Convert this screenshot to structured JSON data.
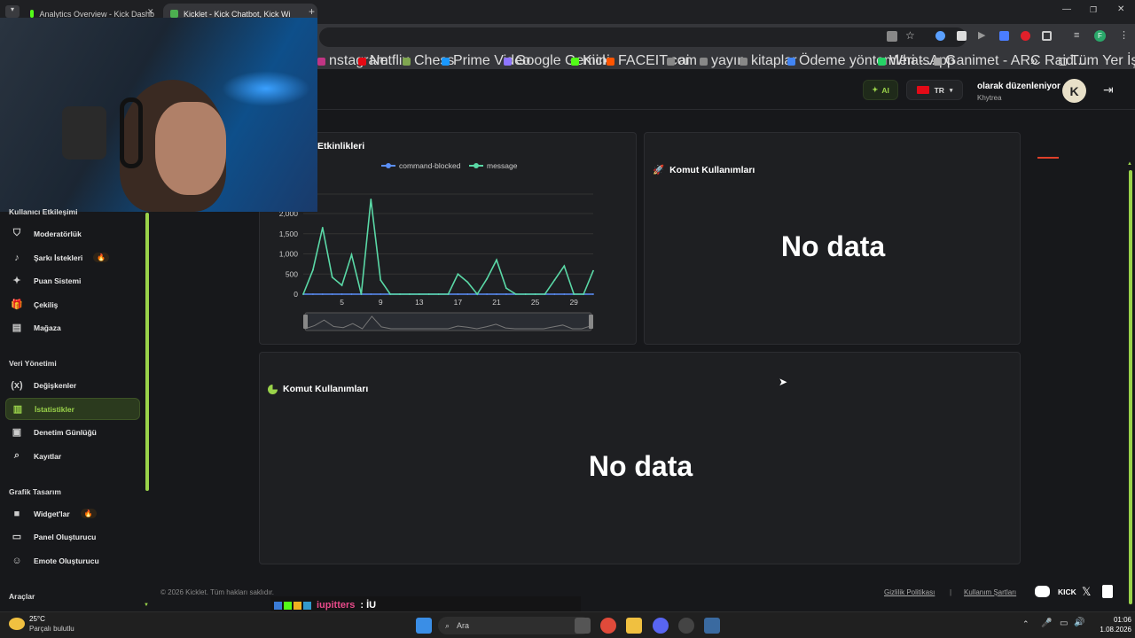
{
  "browser": {
    "tabs": [
      {
        "title": "Analytics Overview - Kick Dashb",
        "active": false
      },
      {
        "title": "Kicklet - Kick Chatbot, Kick Wi",
        "active": true
      }
    ],
    "bookmarks": [
      {
        "label": "nstagram",
        "color": "#c13584"
      },
      {
        "label": "Netflix",
        "color": "#e50914"
      },
      {
        "label": "Chess",
        "color": "#7fa650"
      },
      {
        "label": "Prime Video",
        "color": "#1a98ff"
      },
      {
        "label": "Google Gemini",
        "color": "#8e75ff"
      },
      {
        "label": "Kick",
        "color": "#53fc18"
      },
      {
        "label": "FACEIT.com",
        "color": "#ff5500"
      },
      {
        "label": "ai",
        "color": "#888888"
      },
      {
        "label": "yayın",
        "color": "#888888"
      },
      {
        "label": "kitaplar",
        "color": "#888888"
      },
      {
        "label": "Ödeme yöntemleri -...",
        "color": "#4285f4"
      },
      {
        "label": "WhatsApp",
        "color": "#25d366"
      },
      {
        "label": "Ganimet - ARC Raid...",
        "color": "#aaaaaa"
      }
    ],
    "bookmarks_more": "»",
    "all_bookmarks": "Tüm Yer İşaretleri"
  },
  "header": {
    "ai_label": "AI",
    "lang": "TR",
    "username": "olarak düzenleniyor",
    "channel": "Khytrea",
    "avatar_letter": "K"
  },
  "sidebar": {
    "sections": [
      {
        "title": "Kullanıcı Etkileşimi",
        "items": [
          {
            "label": "Moderatörlük",
            "icon": "shield-icon",
            "glyph": "⛉"
          },
          {
            "label": "Şarkı İstekleri",
            "icon": "music-icon",
            "glyph": "♪",
            "hot": true
          },
          {
            "label": "Puan Sistemi",
            "icon": "sparkle-icon",
            "glyph": "✦"
          },
          {
            "label": "Çekiliş",
            "icon": "gift-icon",
            "glyph": "🎁"
          },
          {
            "label": "Mağaza",
            "icon": "store-icon",
            "glyph": "▤"
          }
        ]
      },
      {
        "title": "Veri Yönetimi",
        "items": [
          {
            "label": "Değişkenler",
            "icon": "variable-icon",
            "glyph": "(x)"
          },
          {
            "label": "İstatistikler",
            "icon": "stats-icon",
            "glyph": "▥",
            "active": true
          },
          {
            "label": "Denetim Günlüğü",
            "icon": "audit-log-icon",
            "glyph": "▣"
          },
          {
            "label": "Kayıtlar",
            "icon": "logs-icon",
            "glyph": "⌕"
          }
        ]
      },
      {
        "title": "Grafik Tasarım",
        "items": [
          {
            "label": "Widget'lar",
            "icon": "video-icon",
            "glyph": "■",
            "hot": true
          },
          {
            "label": "Panel Oluşturucu",
            "icon": "panel-icon",
            "glyph": "▭"
          },
          {
            "label": "Emote Oluşturucu",
            "icon": "smile-icon",
            "glyph": "☺"
          }
        ]
      },
      {
        "title": "Araçlar",
        "items": []
      }
    ],
    "hot_glyph": "🔥"
  },
  "cards": {
    "events_title": "Etkinlikleri",
    "usage_title_1": "Komut Kullanımları",
    "usage_title_2": "Komut Kullanımları",
    "no_data": "No data"
  },
  "chart_data": {
    "type": "line",
    "title": "Etkinlikleri",
    "x": [
      1,
      2,
      3,
      4,
      5,
      6,
      7,
      8,
      9,
      10,
      11,
      12,
      13,
      14,
      15,
      16,
      17,
      18,
      19,
      20,
      21,
      22,
      23,
      24,
      25,
      26,
      27,
      28,
      29,
      30,
      31
    ],
    "x_ticks": [
      5,
      9,
      13,
      17,
      21,
      25,
      29
    ],
    "ylim": [
      0,
      2000
    ],
    "y_ticks": [
      0,
      500,
      1000,
      1500,
      2000
    ],
    "y_tick_labels": [
      "0",
      "500",
      "1,000",
      "1,500",
      "2,000"
    ],
    "series": [
      {
        "name": "command-blocked",
        "color": "#5b8ff9",
        "values": [
          0,
          0,
          0,
          0,
          0,
          0,
          0,
          0,
          0,
          0,
          0,
          0,
          0,
          0,
          0,
          0,
          0,
          0,
          0,
          0,
          0,
          0,
          0,
          0,
          0,
          0,
          0,
          0,
          0,
          0,
          0
        ]
      },
      {
        "name": "message",
        "color": "#5ad8a6",
        "values": [
          0,
          600,
          1650,
          420,
          220,
          980,
          0,
          2350,
          350,
          0,
          0,
          0,
          0,
          0,
          0,
          0,
          500,
          300,
          0,
          380,
          850,
          150,
          0,
          0,
          0,
          0,
          350,
          700,
          0,
          0,
          580
        ]
      }
    ],
    "legend": "top-center"
  },
  "footer": {
    "copyright": "© 2026 Kicklet. Tüm hakları saklıdır.",
    "privacy": "Gizlilik Politikası",
    "separator": "|",
    "terms": "Kullanım Şartları",
    "kick_label": "KICK"
  },
  "overlay": {
    "chat_user": "iupitters",
    "chat_msg": ": İU"
  },
  "taskbar": {
    "temp": "25°C",
    "weather": "Parçalı bulutlu",
    "search": "Ara",
    "time": "01:06",
    "date": "1.08.2026"
  }
}
